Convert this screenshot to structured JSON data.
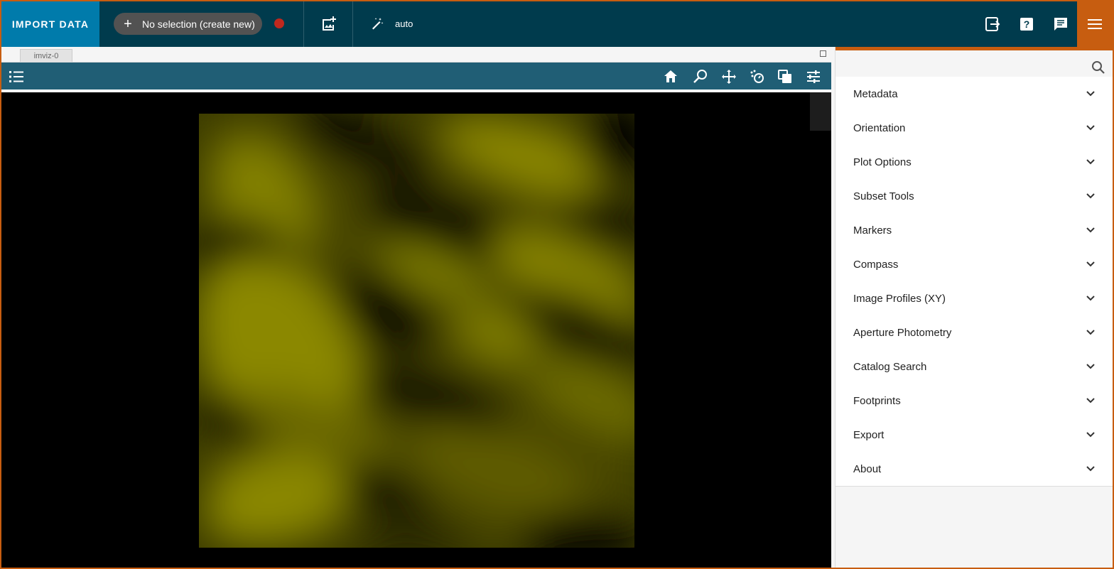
{
  "appbar": {
    "import_label": "IMPORT DATA",
    "selection_label": "No selection (create new)",
    "auto_label": "auto",
    "colors": {
      "bar": "#003b4d",
      "import": "#007bab",
      "accent": "#c75d10",
      "record": "#c0281e"
    }
  },
  "viewer": {
    "tab_label": "imviz-0",
    "tools": [
      "home-icon",
      "zoom-icon",
      "pan-icon",
      "stretch-icon",
      "layers-icon",
      "settings-icon"
    ]
  },
  "panel": {
    "plugins": [
      "Metadata",
      "Orientation",
      "Plot Options",
      "Subset Tools",
      "Markers",
      "Compass",
      "Image Profiles (XY)",
      "Aperture Photometry",
      "Catalog Search",
      "Footprints",
      "Export",
      "About"
    ]
  }
}
